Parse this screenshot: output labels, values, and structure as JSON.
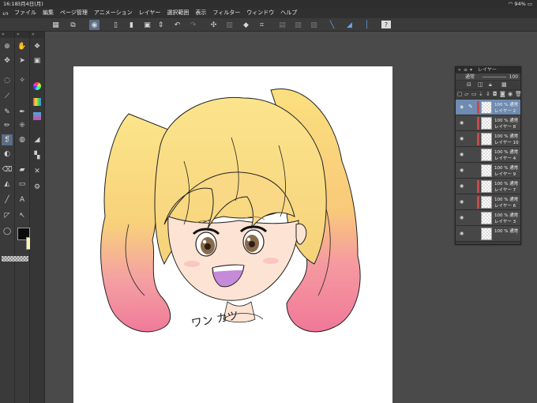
{
  "status_bar": {
    "time": "16:18",
    "date": "3月4日(月)",
    "battery": "94%"
  },
  "menu": [
    "ファイル",
    "編集",
    "ページ管理",
    "アニメーション",
    "レイヤー",
    "選択範囲",
    "表示",
    "フィルター",
    "ウィンドウ",
    "ヘルプ"
  ],
  "layer_palette": {
    "title": "レイヤー",
    "blend_mode": "通常",
    "opacity": "100",
    "layers": [
      {
        "opacity": "100 %",
        "blend": "通常",
        "name": "レイヤー 2",
        "selected": true,
        "mark": "#c24d4d"
      },
      {
        "opacity": "100 %",
        "blend": "通常",
        "name": "レイヤー 8",
        "selected": false,
        "mark": "#c24d4d"
      },
      {
        "opacity": "100 %",
        "blend": "通常",
        "name": "レイヤー 10",
        "selected": false,
        "mark": "#c24d4d"
      },
      {
        "opacity": "100 %",
        "blend": "通常",
        "name": "レイヤー 4",
        "selected": false,
        "mark": ""
      },
      {
        "opacity": "100 %",
        "blend": "通常",
        "name": "レイヤー 9",
        "selected": false,
        "mark": ""
      },
      {
        "opacity": "100 %",
        "blend": "通常",
        "name": "レイヤー 7",
        "selected": false,
        "mark": "#c24d4d"
      },
      {
        "opacity": "100 %",
        "blend": "通常",
        "name": "レイヤー 6",
        "selected": false,
        "mark": "#c24d4d"
      },
      {
        "opacity": "100 %",
        "blend": "通常",
        "name": "レイヤー 3",
        "selected": false,
        "mark": ""
      },
      {
        "opacity": "100 %",
        "blend": "通常",
        "name": "",
        "selected": false,
        "mark": ""
      }
    ]
  },
  "canvas": {
    "signature": "ワン カツ"
  },
  "colors": {
    "main": "#0b0b0b",
    "sub": "#fdf5b0",
    "accent": "#5b6e86"
  }
}
